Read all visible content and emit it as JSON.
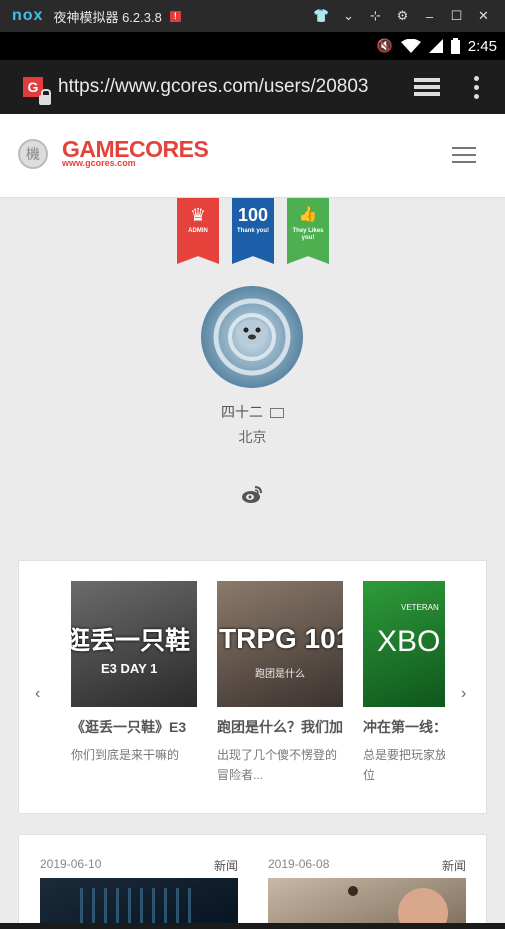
{
  "emulator": {
    "logo": "nox",
    "title": "夜神模拟器 6.2.3.8",
    "alert": "!"
  },
  "status_bar": {
    "time": "2:45"
  },
  "browser": {
    "url": "https://www.gcores.com/users/20803",
    "favicon_letter": "G"
  },
  "site": {
    "logo": "GAMECORES",
    "logo_sub": "www.gcores.com",
    "badge_glyph": "機"
  },
  "badges": [
    {
      "main": "♛",
      "sub": "ADMIN",
      "color": "#e4423b"
    },
    {
      "main": "100",
      "sub": "Thank you!",
      "color": "#1c5ea8"
    },
    {
      "main": "👍",
      "sub": "They Likes you!",
      "color": "#4caf50"
    }
  ],
  "profile": {
    "username": "四十二",
    "location": "北京"
  },
  "carousel": {
    "prev": "‹",
    "next": "›",
    "items": [
      {
        "thumb_text": "逛丢一只鞋",
        "thumb_sub": "E3 DAY 1",
        "title": "《逛丢一只鞋》E3",
        "desc": "你们到底是来干嘛的"
      },
      {
        "thumb_text": "TRPG 101",
        "thumb_sub": "跑团是什么",
        "title": "跑团是什么？我们加",
        "desc": "出现了几个傻不愣登的冒险者..."
      },
      {
        "thumb_text": "XBO",
        "thumb_sub": "VETERAN",
        "title": "冲在第一线：",
        "desc": "总是要把玩家放在第一位"
      }
    ]
  },
  "news": [
    {
      "date": "2019-06-10",
      "tag": "新闻"
    },
    {
      "date": "2019-06-08",
      "tag": "新闻"
    }
  ]
}
